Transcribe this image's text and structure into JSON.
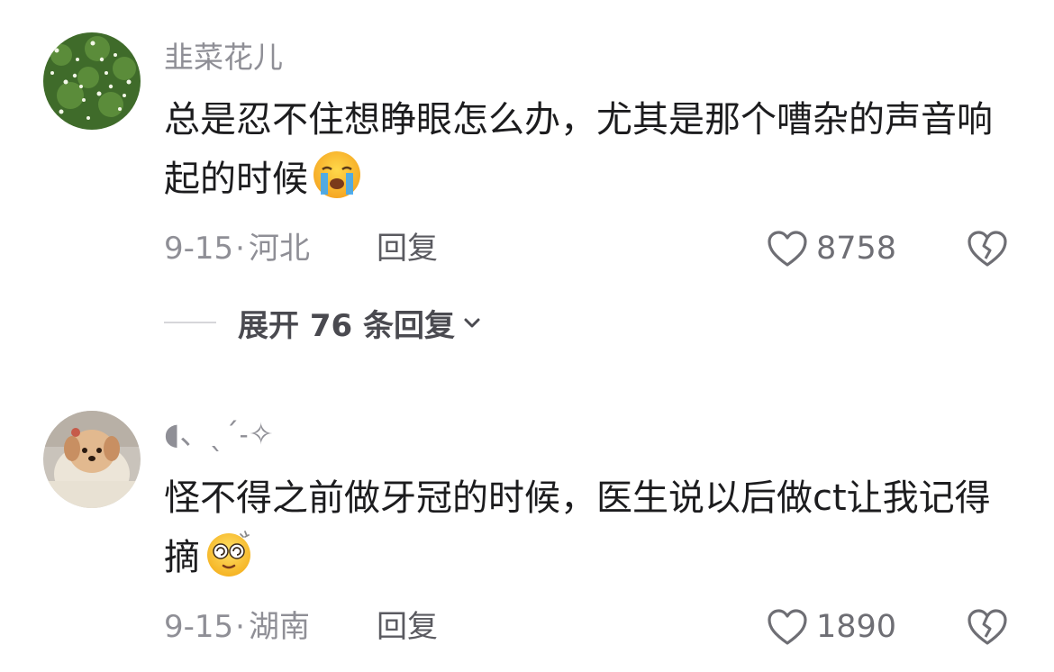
{
  "comments": [
    {
      "username": "韭菜花儿",
      "text": "总是忍不住想睁眼怎么办，尤其是那个嘈杂的声音响起的时候",
      "emoji": "loudly-crying-face",
      "date": "9-15",
      "dot": "·",
      "location": "河北",
      "reply_label": "回复",
      "likes": "8758",
      "expand_label": "展开 76 条回复"
    },
    {
      "username": "◖、ˎˊ˗✧",
      "text": "怪不得之前做牙冠的时候，医生说以后做ct让我记得摘",
      "emoji": "dizzy-face",
      "date": "9-15",
      "dot": "·",
      "location": "湖南",
      "reply_label": "回复",
      "likes": "1890"
    }
  ],
  "icons": {
    "like": "heart-outline-icon",
    "dislike": "broken-heart-icon",
    "expand": "chevron-down-icon"
  },
  "colors": {
    "text": "#1c1c1e",
    "muted": "#8f8f96",
    "reply": "#5a5a60"
  }
}
